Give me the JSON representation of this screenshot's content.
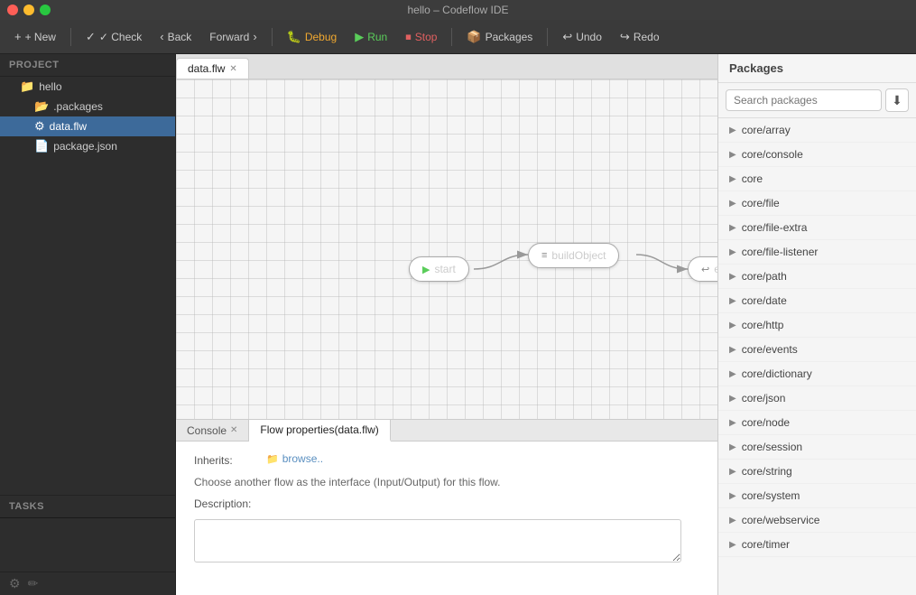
{
  "window": {
    "title": "hello – Codeflow IDE"
  },
  "toolbar": {
    "new_label": "+ New",
    "check_label": "✓ Check",
    "back_label": "Back",
    "forward_label": "Forward",
    "debug_label": "Debug",
    "run_label": "Run",
    "stop_label": "Stop",
    "packages_label": "Packages",
    "undo_label": "Undo",
    "redo_label": "Redo"
  },
  "sidebar": {
    "project_label": "Project",
    "hello_folder": "hello",
    "packages_item": ".packages",
    "data_flw_item": "data.flw",
    "package_json_item": "package.json",
    "tasks_label": "Tasks"
  },
  "editor": {
    "tab_label": "data.flw",
    "nodes": [
      {
        "id": "start",
        "label": "start",
        "icon": "▶",
        "type": "start"
      },
      {
        "id": "buildObject",
        "label": "buildObject",
        "icon": "≡",
        "type": "build"
      },
      {
        "id": "end",
        "label": "end",
        "icon": "↩",
        "type": "end"
      }
    ]
  },
  "bottom_panel": {
    "console_tab": "Console",
    "flow_props_tab": "Flow properties(data.flw)",
    "inherits_label": "Inherits:",
    "browse_label": "browse..",
    "description_note": "Choose another flow as the interface (Input/Output) for this flow.",
    "description_label": "Description:"
  },
  "packages": {
    "panel_title": "Packages",
    "search_placeholder": "Search packages",
    "download_icon": "⬇",
    "items": [
      "core/array",
      "core/console",
      "core",
      "core/file",
      "core/file-extra",
      "core/file-listener",
      "core/path",
      "core/date",
      "core/http",
      "core/events",
      "core/dictionary",
      "core/json",
      "core/node",
      "core/session",
      "core/string",
      "core/system",
      "core/webservice",
      "core/timer"
    ]
  }
}
